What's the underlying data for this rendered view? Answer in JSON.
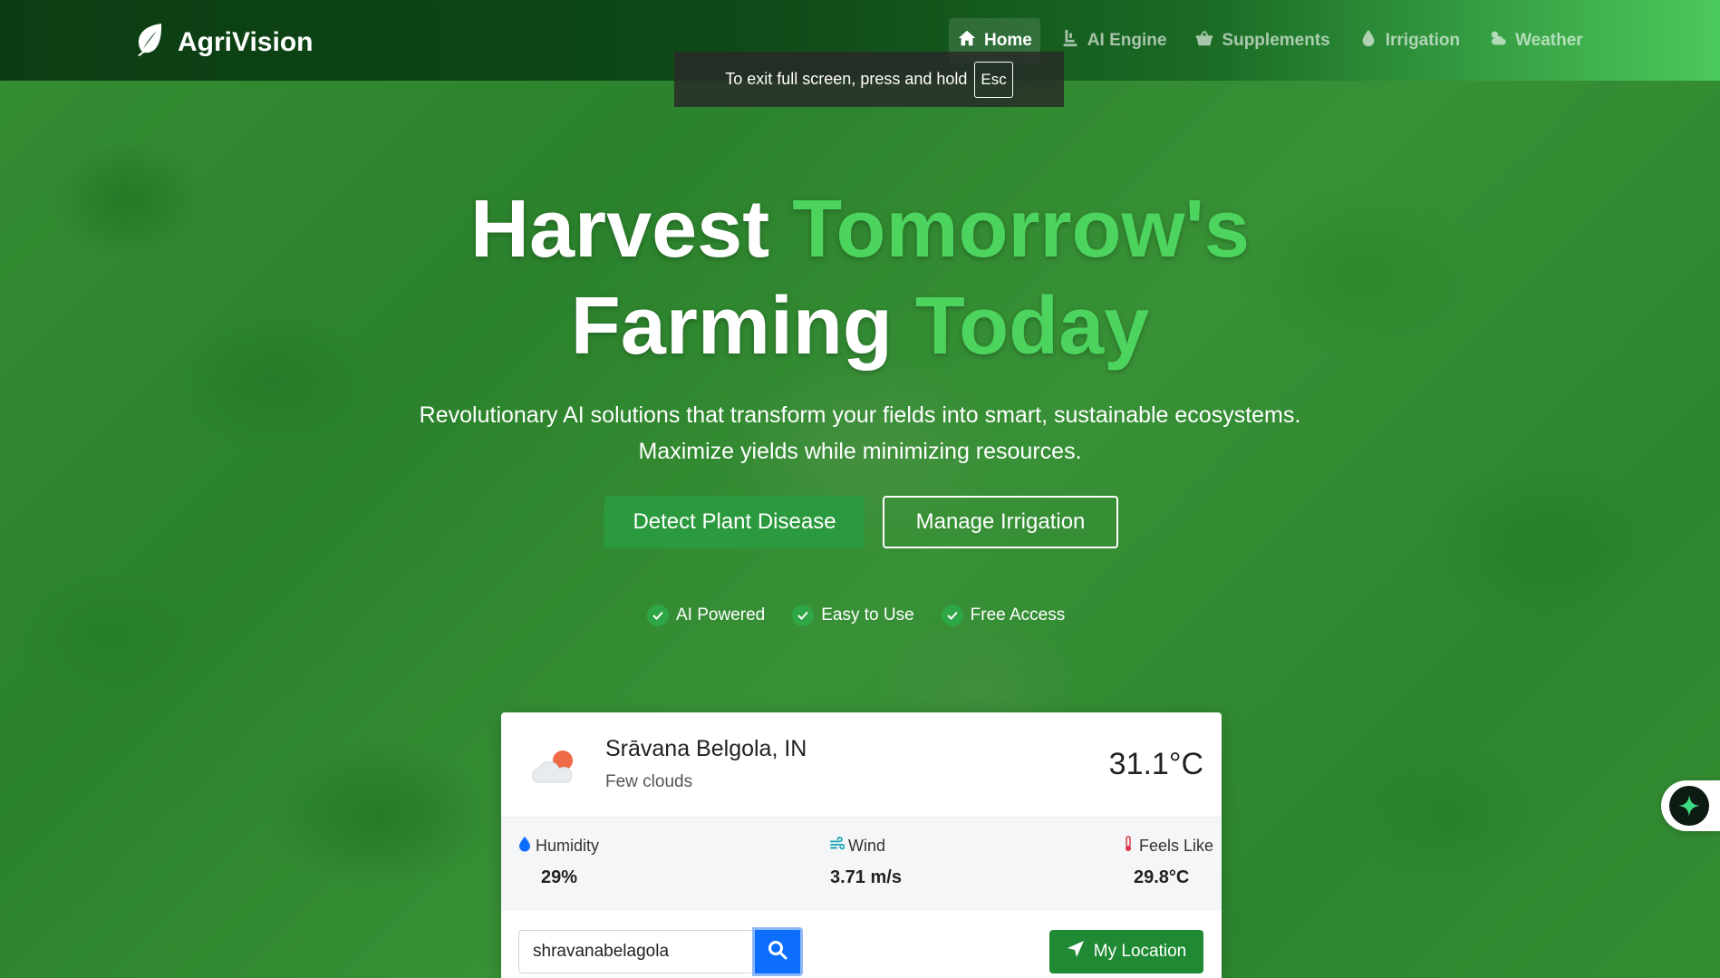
{
  "brand": {
    "name": "AgriVision",
    "icon": "leaf-icon"
  },
  "nav": {
    "items": [
      {
        "label": "Home",
        "icon": "home-icon",
        "active": true
      },
      {
        "label": "AI Engine",
        "icon": "robot-icon",
        "active": false
      },
      {
        "label": "Supplements",
        "icon": "basket-icon",
        "active": false
      },
      {
        "label": "Irrigation",
        "icon": "droplet-icon",
        "active": false
      },
      {
        "label": "Weather",
        "icon": "cloud-sun-icon",
        "active": false
      }
    ]
  },
  "fullscreen_notice": {
    "text": "To exit full screen, press and hold",
    "key": "Esc"
  },
  "hero": {
    "title_line1_white": "Harvest ",
    "title_line1_accent": "Tomorrow's",
    "title_line2_white": "Farming ",
    "title_line2_accent": "Today",
    "subtitle_line1": "Revolutionary AI solutions that transform your fields into smart, sustainable ecosystems.",
    "subtitle_line2": "Maximize yields while minimizing resources.",
    "primary_button": "Detect Plant Disease",
    "secondary_button": "Manage Irrigation",
    "features": [
      "AI Powered",
      "Easy to Use",
      "Free Access"
    ]
  },
  "weather": {
    "location": "Srāvana Belgola, IN",
    "condition": "Few clouds",
    "temperature": "31.1°C",
    "humidity_label": "Humidity",
    "humidity_value": "29%",
    "wind_label": "Wind",
    "wind_value": "3.71 m/s",
    "feels_label": "Feels Like",
    "feels_value": "29.8°C",
    "search_value": "shravanabelagola",
    "location_button": "My Location"
  },
  "colors": {
    "accent_green": "#4cd45f",
    "button_green": "#2b9a3e",
    "search_blue": "#0d6efd"
  }
}
